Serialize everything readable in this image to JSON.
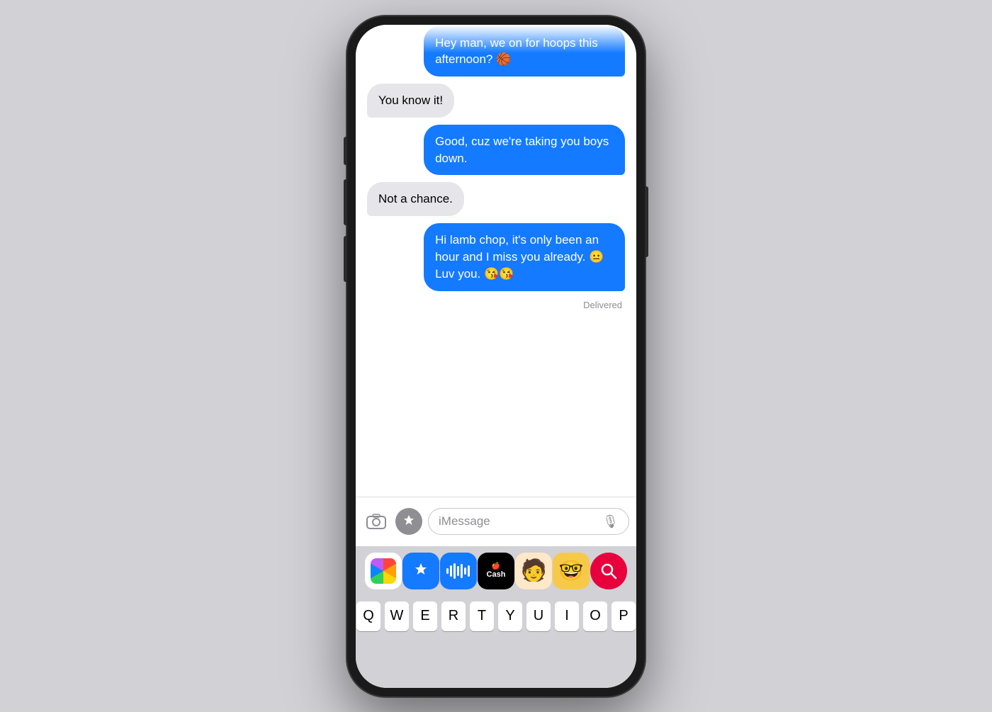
{
  "messages": [
    {
      "id": "msg1",
      "type": "sent",
      "text": "Hey man, we on for hoops this afternoon? 🏀",
      "partial": true
    },
    {
      "id": "msg2",
      "type": "received",
      "text": "You know it!"
    },
    {
      "id": "msg3",
      "type": "sent",
      "text": "Good, cuz we're taking you boys down."
    },
    {
      "id": "msg4",
      "type": "received",
      "text": "Not a chance."
    },
    {
      "id": "msg5",
      "type": "sent",
      "text": "Hi lamb chop, it's only been an hour and I miss you already. 😐 Luv you. 😘😘"
    }
  ],
  "delivered_label": "Delivered",
  "input_placeholder": "iMessage",
  "keyboard": {
    "row1": [
      "Q",
      "W",
      "E",
      "R",
      "T",
      "Y",
      "U",
      "I",
      "O",
      "P"
    ]
  },
  "apps": [
    {
      "name": "Photos",
      "icon": "photos"
    },
    {
      "name": "App Store",
      "icon": "appstore"
    },
    {
      "name": "Audio",
      "icon": "audio"
    },
    {
      "name": "Apple Cash",
      "icon": "cash"
    },
    {
      "name": "Memoji",
      "icon": "memoji"
    },
    {
      "name": "Animoji",
      "icon": "animoji"
    },
    {
      "name": "Search",
      "icon": "search"
    }
  ]
}
